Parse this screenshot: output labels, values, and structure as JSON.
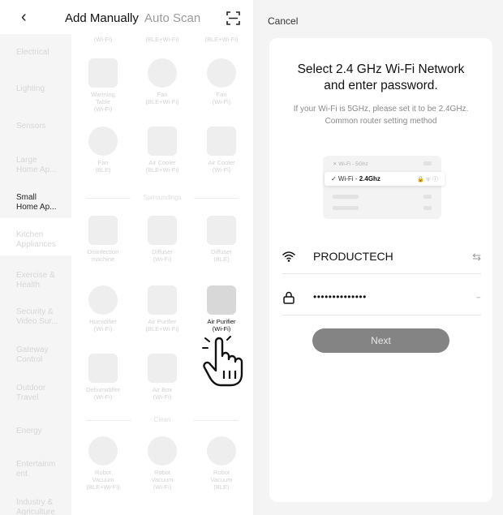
{
  "header": {
    "back_icon": "chevron-left-icon",
    "tab_manual": "Add Manually",
    "tab_auto": "Auto Scan",
    "scan_icon": "scan-icon"
  },
  "sidebar": {
    "items": [
      {
        "label": "Electrical"
      },
      {
        "label": "Lighting"
      },
      {
        "label": "Sensors"
      },
      {
        "label": "Large\nHome Ap..."
      },
      {
        "label": "Small\nHome Ap..."
      },
      {
        "label": "Kitchen\nAppliances"
      },
      {
        "label": "Exercise &\nHealth"
      },
      {
        "label": "Security &\nVideo Sur..."
      },
      {
        "label": "Gateway\nControl"
      },
      {
        "label": "Outdoor\nTravel"
      },
      {
        "label": "Energy"
      },
      {
        "label": "Entertainm\nent"
      },
      {
        "label": "Industry &\nAgriculture"
      }
    ],
    "active": "Small\nHome Ap..."
  },
  "devices": {
    "row0": [
      "(Wi-Fi)",
      "(BLE+Wi-Fi)",
      "(BLE+Wi-Fi)"
    ],
    "row1": [
      "Warming\nTable\n(Wi-Fi)",
      "Fan\n(BLE+Wi-Fi)",
      "Fan\n(Wi-Fi)"
    ],
    "row2": [
      "Fan\n(BLE)",
      "Air Cooler\n(BLE+Wi-Fi)",
      "Air Cooler\n(Wi-Fi)"
    ],
    "section_surroundings": "Surroundings",
    "row3": [
      "Disinfection\nmachine",
      "Diffuser\n(Wi-Fi)",
      "Diffuser\n(BLE)"
    ],
    "row4": [
      "Humidifier\n(Wi-Fi)",
      "Air Purifier\n(BLE+Wi-Fi)",
      "Air Purifier\n(Wi-Fi)"
    ],
    "row5": [
      "Dehumidifier\n(Wi-Fi)",
      "Air Box\n(Wi-Fi)"
    ],
    "section_clean": "Clean",
    "row6": [
      "Robot\nVacuum\n(BLE+Wi-Fi)",
      "Robot\nVacuum\n(Wi-Fi)",
      "Robot\nVacuum\n(BLE)"
    ]
  },
  "pointer_icon": "hand-pointer-icon",
  "wifi_screen": {
    "cancel": "Cancel",
    "title": "Select 2.4 GHz Wi-Fi Network\nand enter password.",
    "subtitle": "If your Wi-Fi is 5GHz, please set it to be 2.4GHz. Common router setting method",
    "illus_row1": "✕ Wi-Fi - 5Ghz",
    "illus_sel_prefix": "✓ Wi-Fi - ",
    "illus_sel_bold": "2.4Ghz",
    "illus_sel_icons": "🔒 ᯤ ⓘ",
    "ssid": "PRODUCTECH",
    "password": "••••••••••••••",
    "next": "Next"
  }
}
